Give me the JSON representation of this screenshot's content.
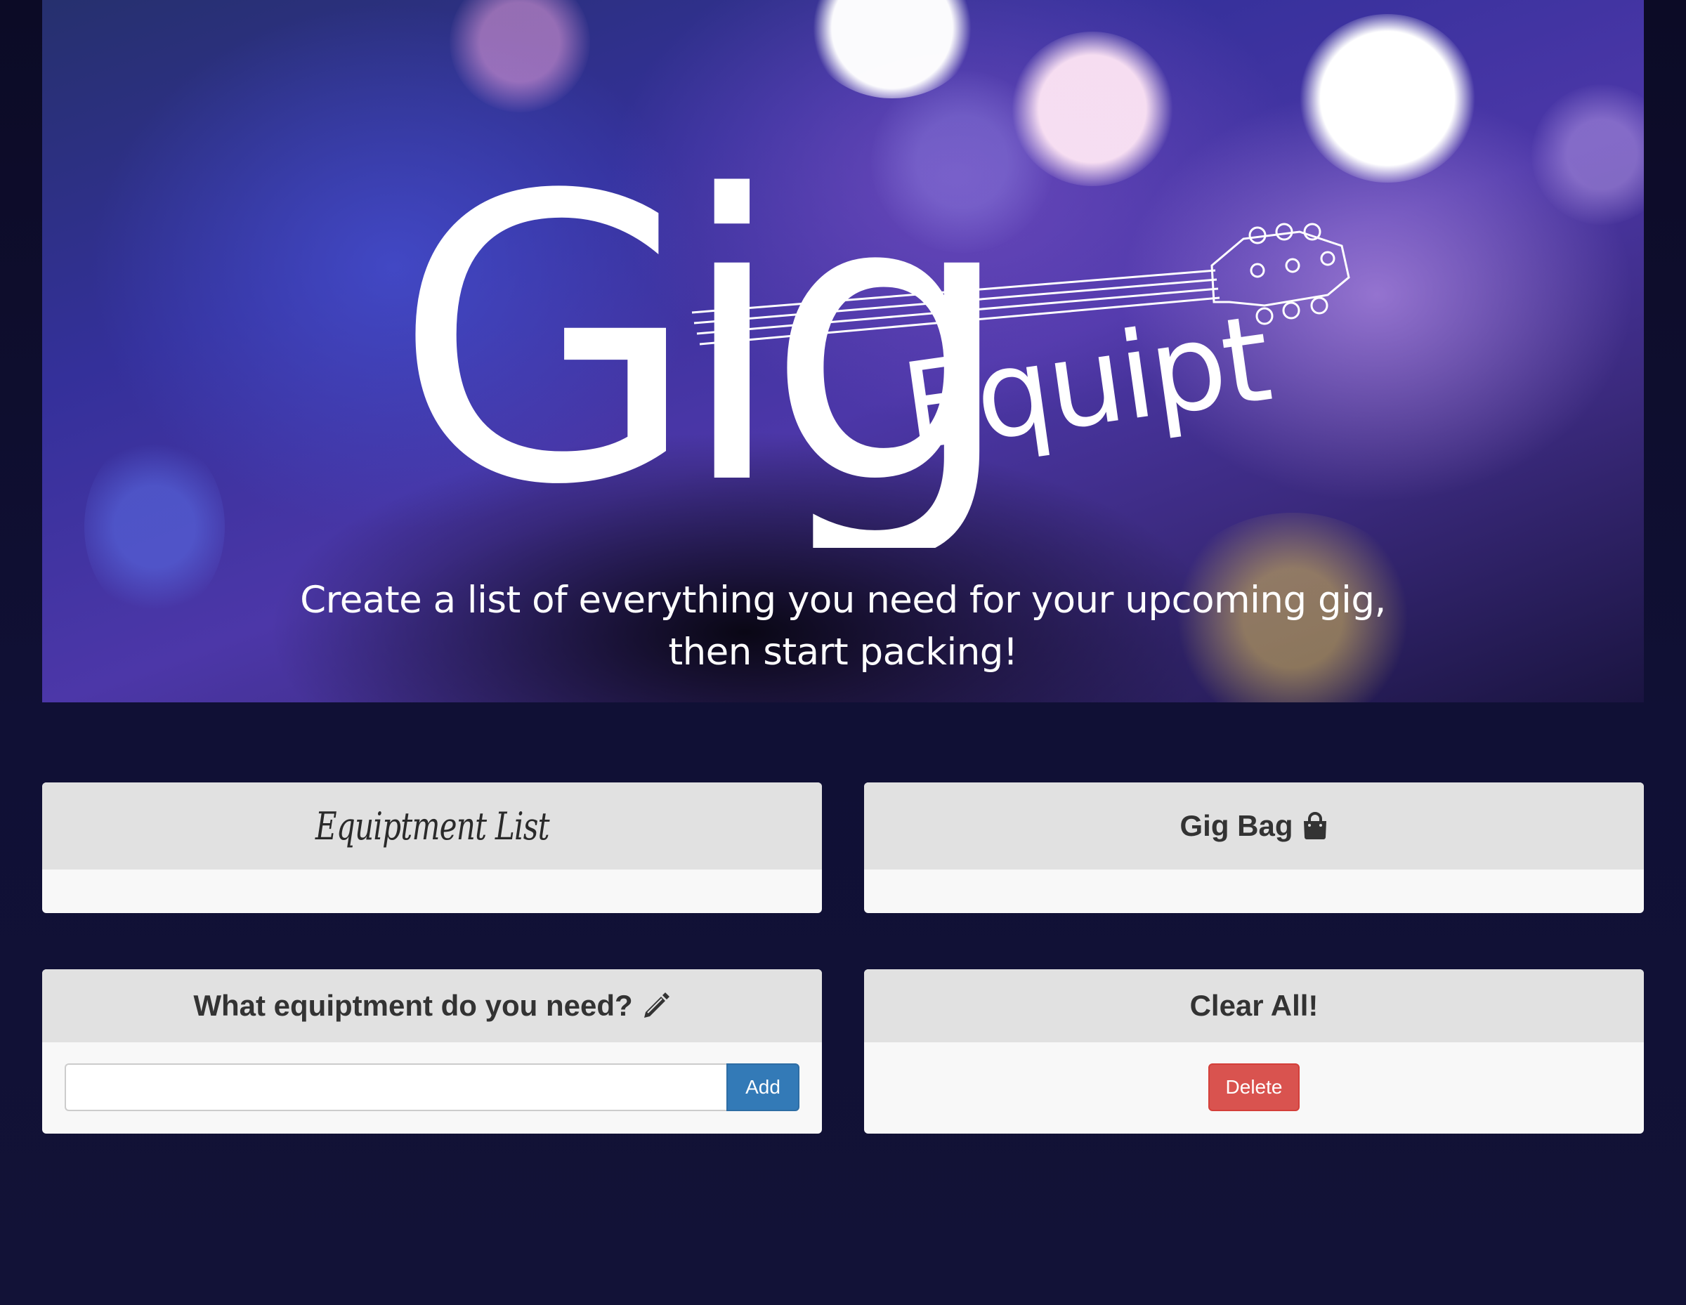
{
  "hero": {
    "logo_main": "Gig",
    "logo_sub": "Equipt",
    "tagline_line1": "Create a list of everything you need for your upcoming gig,",
    "tagline_line2": "then start packing!"
  },
  "equipment_list_panel": {
    "title": "Equiptment List",
    "items": []
  },
  "gig_bag_panel": {
    "title": "Gig Bag",
    "icon": "shopping-bag-icon",
    "items": []
  },
  "add_panel": {
    "title": "What equiptment do you need?",
    "icon": "pencil-icon",
    "input_value": "",
    "add_label": "Add"
  },
  "clear_panel": {
    "title": "Clear All!",
    "delete_label": "Delete"
  },
  "colors": {
    "page_background": "#101035",
    "panel_heading": "#e1e1e1",
    "panel_body": "#f8f8f8",
    "add_button": "#337ab7",
    "delete_button": "#d9534f"
  }
}
